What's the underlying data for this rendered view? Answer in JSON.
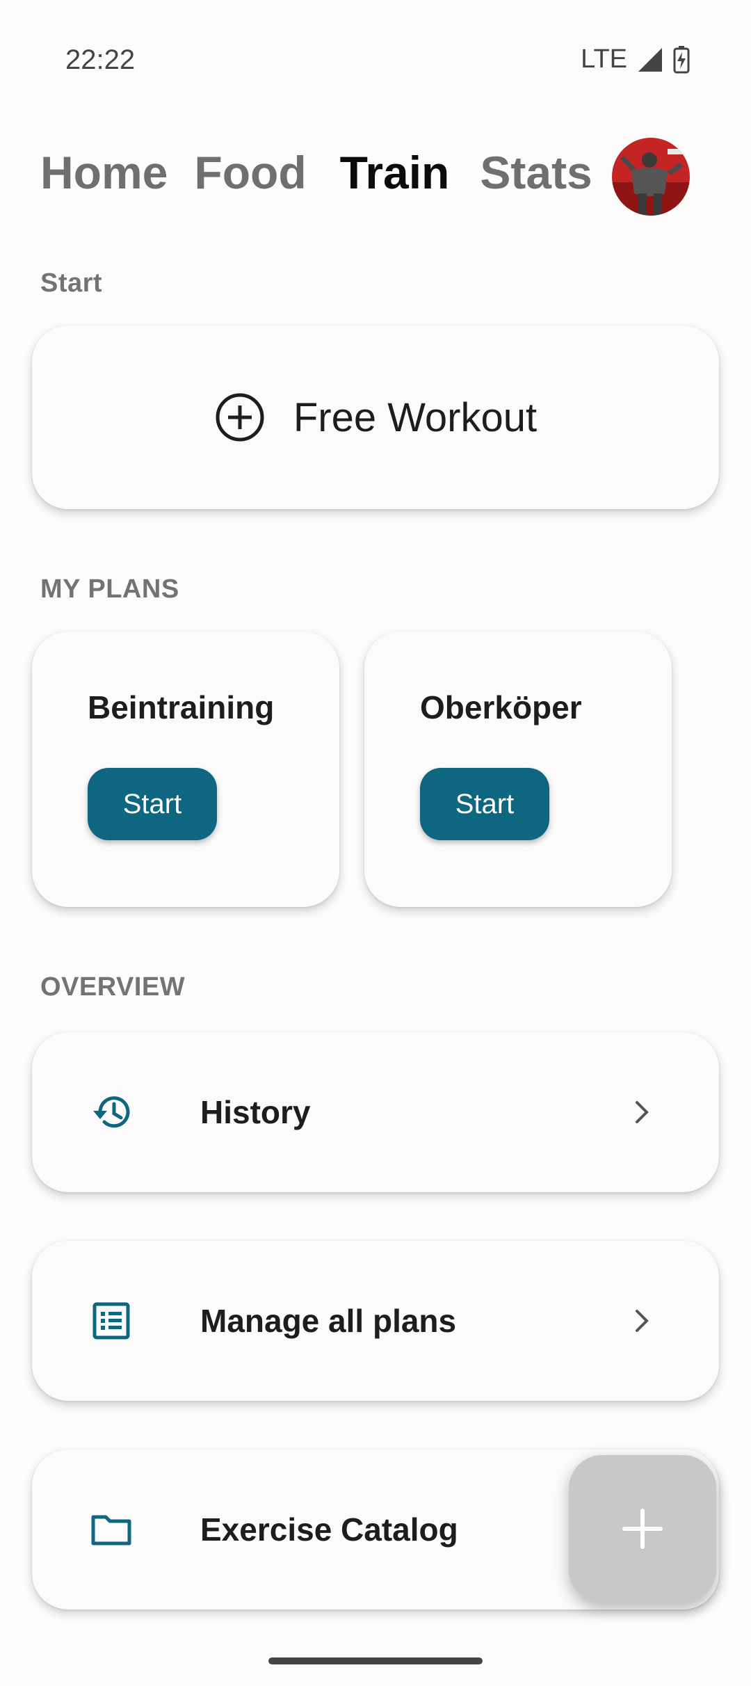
{
  "status": {
    "time": "22:22",
    "network": "LTE"
  },
  "nav": {
    "tabs": [
      "Home",
      "Food",
      "Train",
      "Stats"
    ],
    "active": "Train"
  },
  "sections": {
    "start": "Start",
    "plans": "MY PLANS",
    "overview": "OVERVIEW"
  },
  "free_workout": {
    "label": "Free Workout",
    "icon": "plus-circle-icon"
  },
  "plans": [
    {
      "name": "Beintraining",
      "button": "Start"
    },
    {
      "name": "Oberköper",
      "button": "Start"
    }
  ],
  "overview": [
    {
      "label": "History",
      "icon": "history-icon"
    },
    {
      "label": "Manage all plans",
      "icon": "list-icon"
    },
    {
      "label": "Exercise Catalog",
      "icon": "folder-icon"
    }
  ],
  "colors": {
    "accent": "#0f6680",
    "background": "#fdfcfd",
    "card": "#fbfbfb",
    "fab": "#c8c8c8"
  }
}
